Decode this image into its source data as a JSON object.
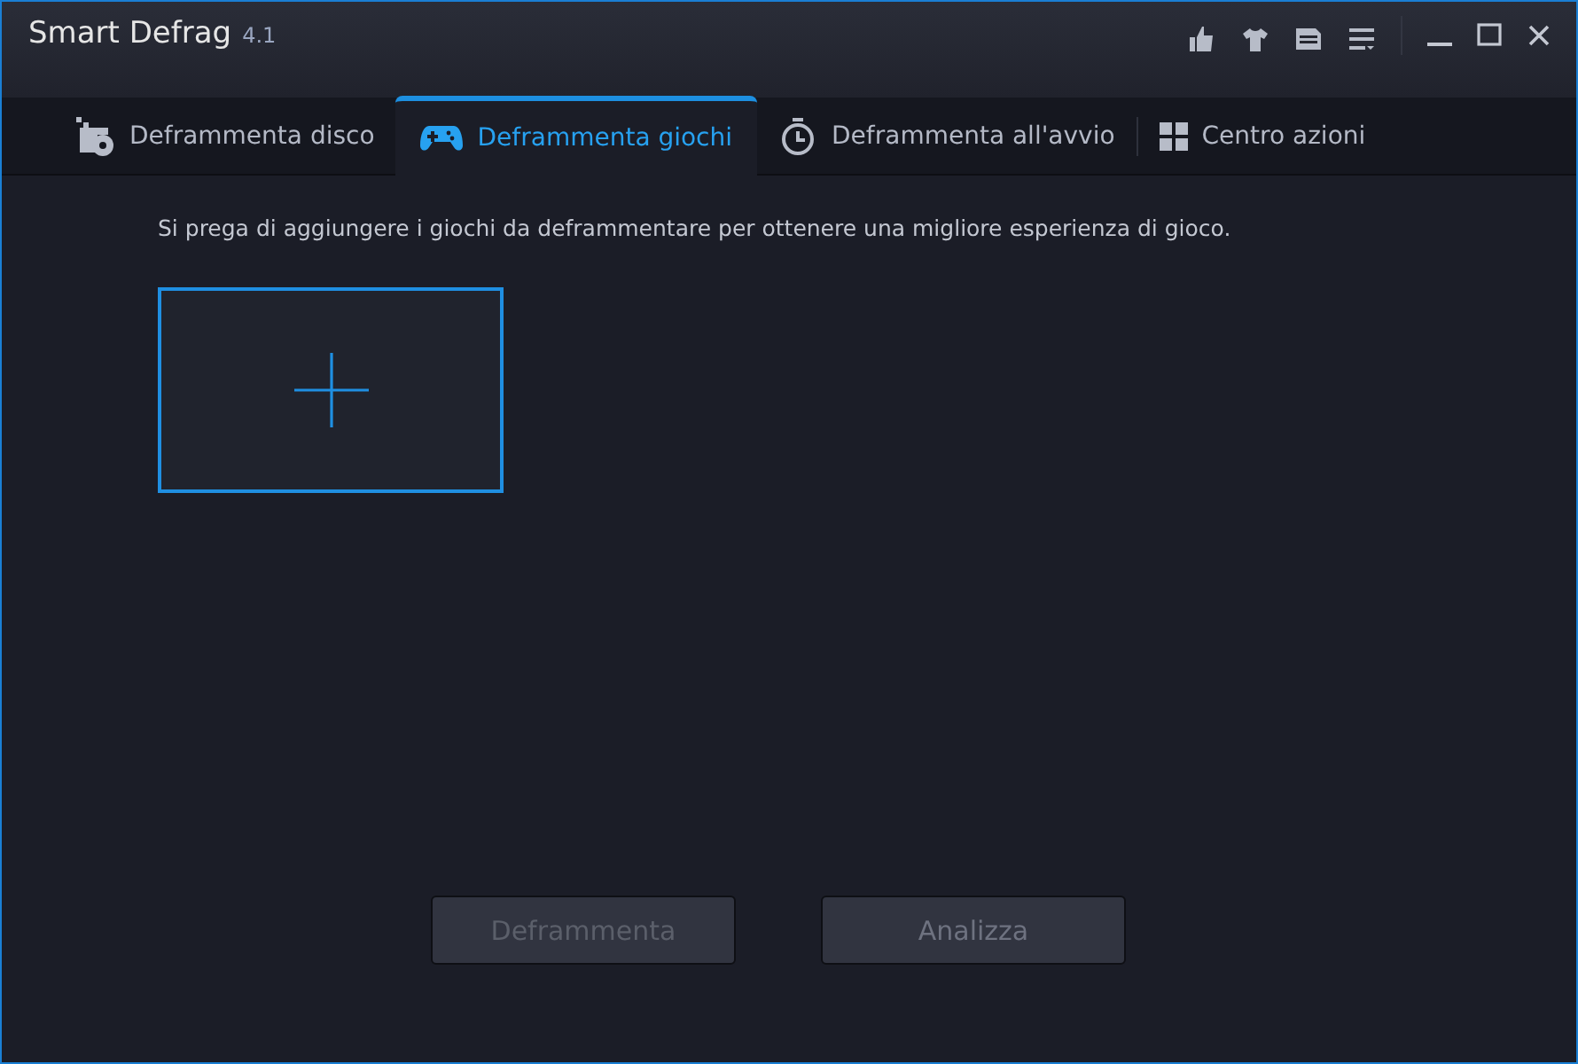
{
  "window": {
    "title": "Smart Defrag",
    "version": "4.1"
  },
  "tabs": [
    {
      "label": "Deframmenta disco",
      "kind": "disk",
      "selected": false
    },
    {
      "label": "Deframmenta giochi",
      "kind": "gamepad",
      "selected": true
    },
    {
      "label": "Deframmenta all'avvio",
      "kind": "timer",
      "selected": false
    },
    {
      "label": "Centro azioni",
      "kind": "grid",
      "selected": false
    }
  ],
  "content": {
    "message": "Si prega di aggiungere i giochi da deframmentare per ottenere una migliore esperienza di gioco."
  },
  "buttons": [
    {
      "label": "Deframmenta",
      "disabled": true
    },
    {
      "label": "Analizza",
      "disabled": false
    }
  ]
}
